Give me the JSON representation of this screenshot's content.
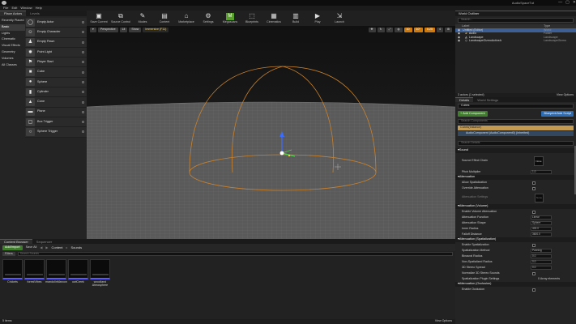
{
  "window": {
    "title": "AudioSpaceTut",
    "buttons": [
      "—",
      "▢",
      "✕"
    ]
  },
  "menu": [
    "File",
    "Edit",
    "Window",
    "Help"
  ],
  "place_panel": {
    "tabs": [
      "Place Actors",
      "Levels"
    ],
    "categories": [
      {
        "label": "Recently Placed",
        "selected": false
      },
      {
        "label": "Basic",
        "selected": true
      },
      {
        "label": "Lights",
        "selected": false
      },
      {
        "label": "Cinematic",
        "selected": false
      },
      {
        "label": "Visual Effects",
        "selected": false
      },
      {
        "label": "Geometry",
        "selected": false
      },
      {
        "label": "Volumes",
        "selected": false
      },
      {
        "label": "All Classes",
        "selected": false
      }
    ],
    "items": [
      {
        "label": "Empty Actor",
        "icon": "actor-icon"
      },
      {
        "label": "Empty Character",
        "icon": "character-icon"
      },
      {
        "label": "Empty Pawn",
        "icon": "pawn-icon"
      },
      {
        "label": "Point Light",
        "icon": "light-icon"
      },
      {
        "label": "Player Start",
        "icon": "player-start-icon"
      },
      {
        "label": "Cube",
        "icon": "cube-icon"
      },
      {
        "label": "Sphere",
        "icon": "sphere-icon"
      },
      {
        "label": "Cylinder",
        "icon": "cylinder-icon"
      },
      {
        "label": "Cone",
        "icon": "cone-icon"
      },
      {
        "label": "Plane",
        "icon": "plane-icon"
      },
      {
        "label": "Box Trigger",
        "icon": "box-trigger-icon"
      },
      {
        "label": "Sphere Trigger",
        "icon": "sphere-trigger-icon"
      }
    ]
  },
  "toolbar": [
    {
      "label": "Save Current",
      "icon": "save-icon"
    },
    {
      "label": "Source Control",
      "icon": "source-control-icon"
    },
    {
      "label": "Modes",
      "icon": "modes-icon"
    },
    {
      "label": "Content",
      "icon": "content-icon"
    },
    {
      "label": "Marketplace",
      "icon": "marketplace-icon"
    },
    {
      "label": "Settings",
      "icon": "settings-icon"
    },
    {
      "label": "Blueprints",
      "icon": "blueprints-icon"
    },
    {
      "label": "Cinematics",
      "icon": "cinematics-icon"
    },
    {
      "label": "Build",
      "icon": "build-icon"
    },
    {
      "label": "Play",
      "icon": "play-icon"
    },
    {
      "label": "Launch",
      "icon": "launch-icon"
    }
  ],
  "toolbar_extra": {
    "label": "Megascans",
    "icon": "megascans-icon"
  },
  "viewport": {
    "perspective": "Perspective",
    "lit": "Lit",
    "show": "Show",
    "mode": "Immersive (F11)",
    "snap_value": "10",
    "rot_value": "10°",
    "scale_value": "0.25",
    "camera_speed": "4"
  },
  "outliner": {
    "tab": "World Outliner",
    "search_placeholder": "Search...",
    "columns": [
      "Label",
      "Type"
    ],
    "rows": [
      {
        "label": "Untitled (Editor)",
        "type": "World"
      },
      {
        "label": "Audio",
        "type": "Folder"
      },
      {
        "label": "Landscape",
        "type": "Landscape"
      },
      {
        "label": "LandscapeGizmoActiveA",
        "type": "LandscapeGizmo"
      }
    ],
    "footer": "3 actors (1 selected)",
    "view_options": "View Options"
  },
  "details": {
    "tabs": [
      "Details",
      "World Settings"
    ],
    "actor_name": "Cubes",
    "add_component": "+ Add Component",
    "blueprint_button": "Blueprint/Add Script",
    "search_placeholder": "Search Components",
    "component_root": "Cubes(Instance)",
    "component_child": "AudioComponent (AudioComponent0) (Inherited)",
    "search_details_placeholder": "Search Details",
    "sections": [
      {
        "title": "Sound",
        "rows": [
          {
            "label": "Source Effect Chain",
            "kind": "asset",
            "value": "None"
          },
          {
            "label": "Pitch Multiplier",
            "kind": "value",
            "value": "1.0"
          }
        ]
      },
      {
        "title": "Attenuation",
        "rows": [
          {
            "label": "Allow Spatialization",
            "kind": "check"
          },
          {
            "label": "Override Attenuation",
            "kind": "check"
          },
          {
            "label": "Attenuation Settings",
            "kind": "asset",
            "value": "None"
          }
        ]
      },
      {
        "title": "Attenuation (Volume)",
        "rows": [
          {
            "label": "Enable Volume Attenuation",
            "kind": "check"
          },
          {
            "label": "Attenuation Function",
            "kind": "value",
            "value": "Linear"
          },
          {
            "label": "Attenuation Shape",
            "kind": "value",
            "value": "Sphere"
          },
          {
            "label": "Inner Radius",
            "kind": "value",
            "value": "400.0"
          },
          {
            "label": "Falloff Distance",
            "kind": "value",
            "value": "3600.0"
          }
        ]
      },
      {
        "title": "Attenuation (Spatialization)",
        "rows": [
          {
            "label": "Enable Spatialization",
            "kind": "check"
          },
          {
            "label": "Spatialization Method",
            "kind": "value",
            "value": "Panning"
          },
          {
            "label": "Binaural Radius",
            "kind": "value",
            "value": "0.0"
          },
          {
            "label": "Non-Spatialized Radius",
            "kind": "value",
            "value": "0.0"
          },
          {
            "label": "3D Stereo Spread",
            "kind": "value",
            "value": "0.0"
          },
          {
            "label": "Normalize 3D Stereo Sounds",
            "kind": "check"
          },
          {
            "label": "Spatialization Plugin Settings",
            "kind": "value",
            "value": "0 Array elements"
          }
        ]
      },
      {
        "title": "Attenuation (Occlusion)",
        "rows": [
          {
            "label": "Enable Occlusion",
            "kind": "check"
          }
        ]
      }
    ]
  },
  "content_browser": {
    "tabs": [
      "Content Browser",
      "Sequencer"
    ],
    "add_import": "Add/Import",
    "save_all": "Save All",
    "path": [
      "Content",
      "Sounds"
    ],
    "filters": "Filters",
    "search_placeholder": "Search Sounds",
    "assets": [
      {
        "name": "Crickets"
      },
      {
        "name": "forestVibes"
      },
      {
        "name": "mandolinMaroon"
      },
      {
        "name": "owlCreek"
      },
      {
        "name": "woodland Atmosphere"
      }
    ],
    "footer": "5 items",
    "view_options": "View Options"
  },
  "colors": {
    "accent": "#e8a23a",
    "gizmo_blue": "#3a6cff",
    "gizmo_green": "#4bd14b",
    "attenuation": "#c8822e"
  }
}
